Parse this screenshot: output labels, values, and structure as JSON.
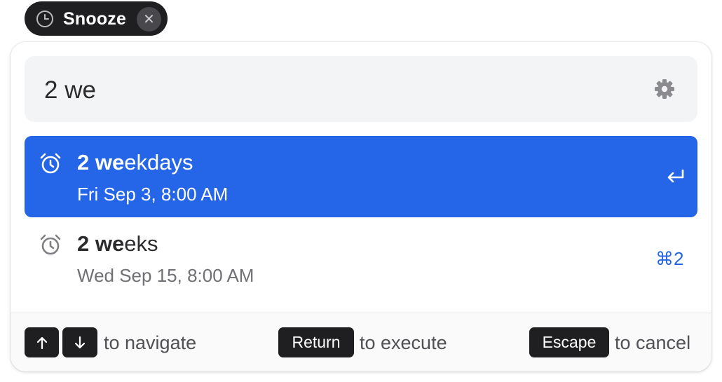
{
  "chip": {
    "label": "Snooze",
    "icon": "clock-icon",
    "close_icon": "close-icon",
    "close_glyph": "✕"
  },
  "search": {
    "value": "2 we",
    "settings_icon": "gear-icon"
  },
  "results": [
    {
      "title_match": "2 we",
      "title_rest": "ekdays",
      "subtitle": "Fri Sep 3, 8:00 AM",
      "icon": "alarm-clock-icon",
      "selected": true,
      "action_icon": "return-key-icon"
    },
    {
      "title_match": "2 we",
      "title_rest": "eks",
      "subtitle": "Wed Sep 15, 8:00 AM",
      "icon": "alarm-clock-icon",
      "selected": false,
      "shortcut": "⌘2"
    }
  ],
  "footer": {
    "navigate_keys": [
      "arrow-up-icon",
      "arrow-down-icon"
    ],
    "navigate_hint": "to navigate",
    "execute_key": "Return",
    "execute_hint": "to execute",
    "cancel_key": "Escape",
    "cancel_hint": "to cancel"
  },
  "colors": {
    "accent": "#2566e8",
    "chip_background": "#1f1f21",
    "search_background": "#f3f4f6",
    "key_background": "#1f1f21"
  }
}
